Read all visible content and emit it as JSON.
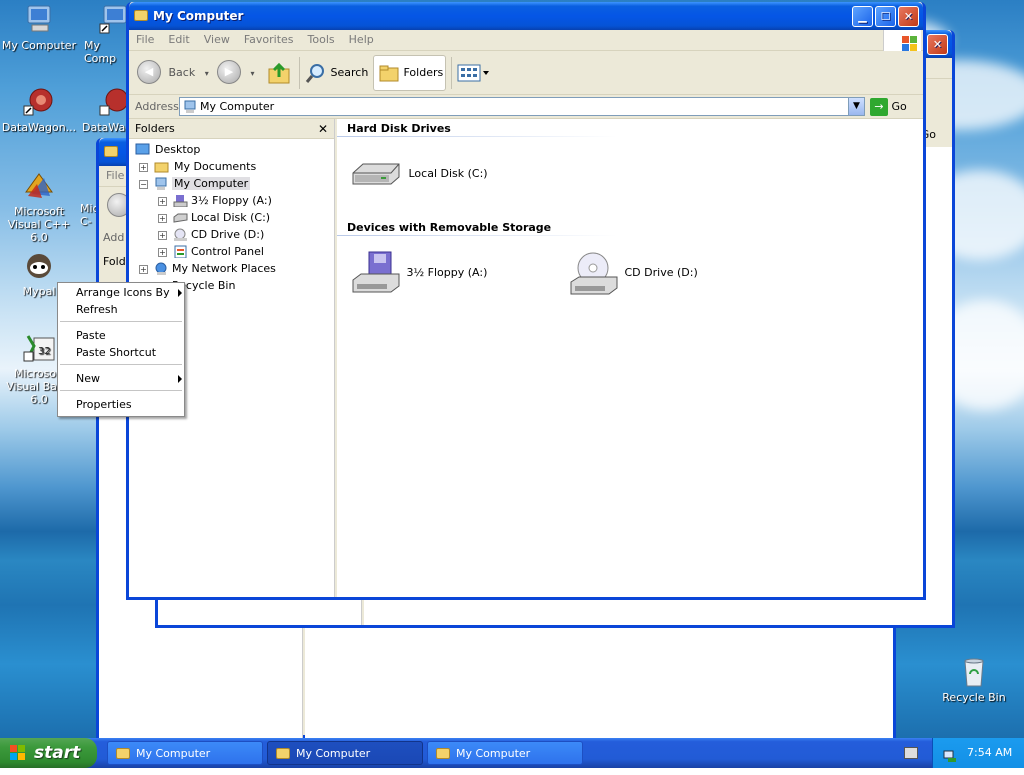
{
  "desktop": {
    "icons": [
      {
        "label": "My Computer",
        "icon": "my-computer-icon"
      },
      {
        "label": "My Comp",
        "icon": "my-computer-shortcut-icon"
      },
      {
        "label": "DataWagon...",
        "icon": "datawagon-icon"
      },
      {
        "label": "DataWag",
        "icon": "datawagon-shortcut-icon"
      },
      {
        "label": "Microsoft Visual C++ 6.0",
        "icon": "visual-cpp-icon"
      },
      {
        "label": "Micr C-",
        "icon": "visual-cpp-shortcut-icon"
      },
      {
        "label": "Mypal",
        "icon": "mypal-icon"
      },
      {
        "label": "Microsoft Visual Basic 6.0",
        "icon": "visual-basic-icon"
      },
      {
        "label": "Recycle Bin",
        "icon": "recycle-bin-icon"
      }
    ]
  },
  "back_window": {
    "menu_partial": "File",
    "address_partial": "Add",
    "folders_partial": "Fold",
    "go_partial": "Go"
  },
  "window": {
    "title": "My Computer",
    "menus": [
      "File",
      "Edit",
      "View",
      "Favorites",
      "Tools",
      "Help"
    ],
    "toolbar": {
      "back_label": "Back",
      "search_label": "Search",
      "folders_label": "Folders"
    },
    "address": {
      "label": "Address",
      "value": "My Computer",
      "go_label": "Go"
    },
    "folders_pane": {
      "title": "Folders",
      "tree": [
        {
          "label": "Desktop",
          "level": 0,
          "expander": ""
        },
        {
          "label": "My Documents",
          "level": 1,
          "expander": "+"
        },
        {
          "label": "My Computer",
          "level": 1,
          "expander": "-"
        },
        {
          "label": "3½ Floppy (A:)",
          "level": 2,
          "expander": "+"
        },
        {
          "label": "Local Disk (C:)",
          "level": 2,
          "expander": "+"
        },
        {
          "label": "CD Drive (D:)",
          "level": 2,
          "expander": "+"
        },
        {
          "label": "Control Panel",
          "level": 2,
          "expander": "+"
        },
        {
          "label": "My Network Places",
          "level": 1,
          "expander": "+"
        },
        {
          "label": "Recycle Bin",
          "level": 1,
          "expander": ""
        }
      ]
    },
    "content": {
      "groups": [
        {
          "title": "Hard Disk Drives",
          "items": [
            {
              "label": "Local Disk (C:)",
              "icon": "hard-disk-icon"
            }
          ]
        },
        {
          "title": "Devices with Removable Storage",
          "items": [
            {
              "label": "3½ Floppy (A:)",
              "icon": "floppy-drive-icon"
            },
            {
              "label": "CD Drive (D:)",
              "icon": "cd-drive-icon"
            }
          ]
        }
      ]
    }
  },
  "context_menu": {
    "items": [
      {
        "label": "Arrange Icons By",
        "submenu": true
      },
      {
        "label": "Refresh",
        "submenu": false
      },
      {
        "label": "Paste",
        "submenu": false
      },
      {
        "label": "Paste Shortcut",
        "submenu": false
      },
      {
        "label": "New",
        "submenu": true
      },
      {
        "label": "Properties",
        "submenu": false
      }
    ]
  },
  "taskbar": {
    "start_label": "start",
    "buttons": [
      {
        "label": "My Computer",
        "active": false
      },
      {
        "label": "My Computer",
        "active": true
      },
      {
        "label": "My Computer",
        "active": false
      }
    ],
    "clock": "7:54 AM"
  }
}
